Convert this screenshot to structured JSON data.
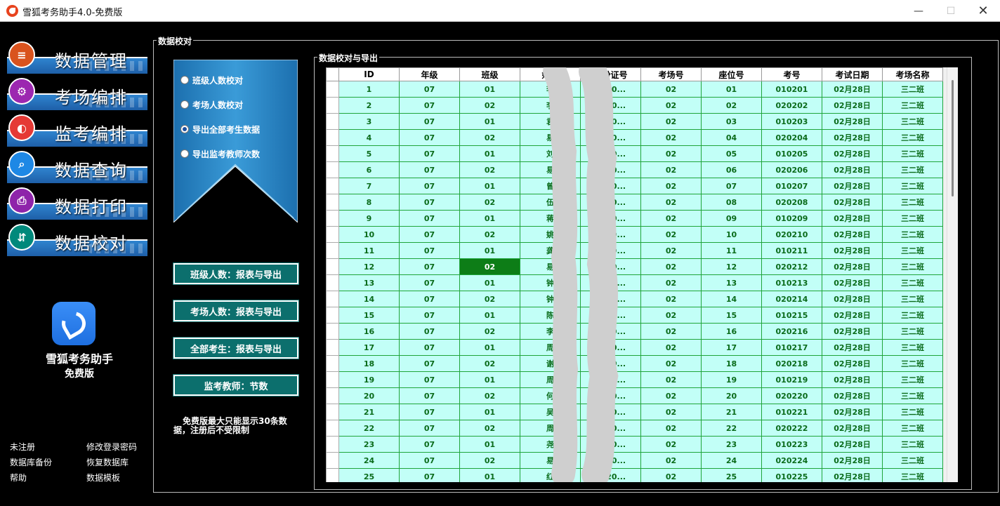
{
  "window": {
    "title": "雪狐考务助手4.0-免费版",
    "min": "—",
    "max": "☐",
    "close": "✕"
  },
  "nav": [
    {
      "label": "数据管理",
      "icon": "database-icon",
      "glyph": "≡",
      "color": "#d9531e"
    },
    {
      "label": "考场编排",
      "icon": "gear-icon",
      "glyph": "⚙",
      "color": "#9c27b0"
    },
    {
      "label": "监考编排",
      "icon": "user-clock-icon",
      "glyph": "◐",
      "color": "#e53935"
    },
    {
      "label": "数据查询",
      "icon": "search-doc-icon",
      "glyph": "⌕",
      "color": "#1e88e5"
    },
    {
      "label": "数据打印",
      "icon": "printer-icon",
      "glyph": "⎙",
      "color": "#8e24aa"
    },
    {
      "label": "数据校对",
      "icon": "compare-icon",
      "glyph": "⇵",
      "color": "#00897b"
    }
  ],
  "brand": {
    "name": "雪狐考务助手",
    "edition": "免费版"
  },
  "footer_links": {
    "unregistered": "未注册",
    "change_password": "修改登录密码",
    "backup": "数据库备份",
    "restore": "恢复数据库",
    "help": "帮助",
    "template": "数据模板"
  },
  "panel": {
    "title": "数据校对",
    "options": [
      "班级人数校对",
      "考场人数校对",
      "导出全部考生数据",
      "导出监考教师次数"
    ],
    "selected_option": 2,
    "buttons": [
      "班级人数：报表与导出",
      "考场人数：报表与导出",
      "全部考生：报表与导出",
      "监考教师：节数"
    ],
    "note": "免费版最大只能显示30条数据，注册后不受限制",
    "table_title": "数据校对与导出"
  },
  "table": {
    "columns": [
      "ID",
      "年级",
      "班级",
      "姓名",
      "身份证号",
      "考场号",
      "座位号",
      "考号",
      "考试日期",
      "考场名称"
    ],
    "selected_cell": [
      11,
      2
    ],
    "rows": [
      [
        "1",
        "07",
        "01",
        "李",
        "3120...",
        "02",
        "01",
        "010201",
        "02月28日",
        "三二班"
      ],
      [
        "2",
        "07",
        "02",
        "李",
        "3120...",
        "02",
        "02",
        "020202",
        "02月28日",
        "三二班"
      ],
      [
        "3",
        "07",
        "01",
        "袁",
        "3120...",
        "02",
        "03",
        "010203",
        "02月28日",
        "三二班"
      ],
      [
        "4",
        "07",
        "02",
        "易",
        "3120...",
        "02",
        "04",
        "020204",
        "02月28日",
        "三二班"
      ],
      [
        "5",
        "07",
        "01",
        "刘",
        "3120...",
        "02",
        "05",
        "010205",
        "02月28日",
        "三二班"
      ],
      [
        "6",
        "07",
        "02",
        "易",
        "3120...",
        "02",
        "06",
        "020206",
        "02月28日",
        "三二班"
      ],
      [
        "7",
        "07",
        "01",
        "曾",
        "3120...",
        "02",
        "07",
        "010207",
        "02月28日",
        "三二班"
      ],
      [
        "8",
        "07",
        "02",
        "伍",
        "3120...",
        "02",
        "08",
        "020208",
        "02月28日",
        "三二班"
      ],
      [
        "9",
        "07",
        "01",
        "蒋",
        "3120...",
        "02",
        "09",
        "010209",
        "02月28日",
        "三二班"
      ],
      [
        "10",
        "07",
        "02",
        "姚",
        "3120...",
        "02",
        "10",
        "020210",
        "02月28日",
        "三二班"
      ],
      [
        "11",
        "07",
        "01",
        "龚",
        "3120...",
        "02",
        "11",
        "010211",
        "02月28日",
        "三二班"
      ],
      [
        "12",
        "07",
        "02",
        "易",
        "3120...",
        "02",
        "12",
        "020212",
        "02月28日",
        "三二班"
      ],
      [
        "13",
        "07",
        "01",
        "钟",
        "3120...",
        "02",
        "13",
        "010213",
        "02月28日",
        "三二班"
      ],
      [
        "14",
        "07",
        "02",
        "钟",
        "3120...",
        "02",
        "14",
        "020214",
        "02月28日",
        "三二班"
      ],
      [
        "15",
        "07",
        "01",
        "陈",
        "3120...",
        "02",
        "15",
        "010215",
        "02月28日",
        "三二班"
      ],
      [
        "16",
        "07",
        "02",
        "李",
        "3120...",
        "02",
        "16",
        "020216",
        "02月28日",
        "三二班"
      ],
      [
        "17",
        "07",
        "01",
        "周",
        "3120...",
        "02",
        "17",
        "010217",
        "02月28日",
        "三二班"
      ],
      [
        "18",
        "07",
        "02",
        "谢",
        "3120...",
        "02",
        "18",
        "020218",
        "02月28日",
        "三二班"
      ],
      [
        "19",
        "07",
        "01",
        "周",
        "3120...",
        "02",
        "19",
        "010219",
        "02月28日",
        "三二班"
      ],
      [
        "20",
        "07",
        "02",
        "何",
        "3120...",
        "02",
        "20",
        "020220",
        "02月28日",
        "三二班"
      ],
      [
        "21",
        "07",
        "01",
        "吴",
        "3120...",
        "02",
        "21",
        "010221",
        "02月28日",
        "三二班"
      ],
      [
        "22",
        "07",
        "02",
        "周",
        "3120...",
        "02",
        "22",
        "020222",
        "02月28日",
        "三二班"
      ],
      [
        "23",
        "07",
        "01",
        "尧",
        "3120...",
        "02",
        "23",
        "010223",
        "02月28日",
        "三二班"
      ],
      [
        "24",
        "07",
        "02",
        "易",
        "3120...",
        "02",
        "24",
        "020224",
        "02月28日",
        "三二班"
      ],
      [
        "25",
        "07",
        "01",
        "红",
        "3120...",
        "02",
        "25",
        "010225",
        "02月28日",
        "三二班"
      ]
    ]
  }
}
